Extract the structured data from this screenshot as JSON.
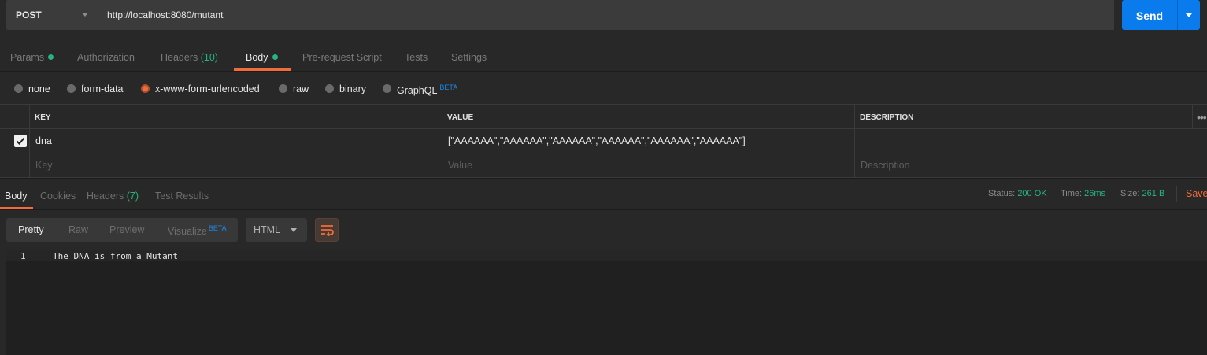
{
  "request": {
    "method": "POST",
    "url": "http://localhost:8080/mutant",
    "send_label": "Send"
  },
  "request_tabs": {
    "params": "Params",
    "authorization": "Authorization",
    "headers": "Headers",
    "headers_count": "(10)",
    "body": "Body",
    "prerequest": "Pre-request Script",
    "tests": "Tests",
    "settings": "Settings"
  },
  "body_types": {
    "none": "none",
    "form_data": "form-data",
    "urlencoded": "x-www-form-urlencoded",
    "raw": "raw",
    "binary": "binary",
    "graphql": "GraphQL",
    "beta": "BETA",
    "selected": "x-www-form-urlencoded"
  },
  "params_table": {
    "headers": {
      "key": "KEY",
      "value": "VALUE",
      "description": "DESCRIPTION"
    },
    "rows": [
      {
        "checked": true,
        "key": "dna",
        "value": "[\"AAAAAA\",\"AAAAAA\",\"AAAAAA\",\"AAAAAA\",\"AAAAAA\",\"AAAAAA\"]",
        "description": ""
      }
    ],
    "placeholders": {
      "key": "Key",
      "value": "Value",
      "description": "Description"
    }
  },
  "response_tabs": {
    "body": "Body",
    "cookies": "Cookies",
    "headers": "Headers",
    "headers_count": "(7)",
    "test_results": "Test Results"
  },
  "response_meta": {
    "status_label": "Status:",
    "status_value": "200 OK",
    "time_label": "Time:",
    "time_value": "26ms",
    "size_label": "Size:",
    "size_value": "261 B",
    "save_label": "Save"
  },
  "response_view": {
    "pretty": "Pretty",
    "raw": "Raw",
    "preview": "Preview",
    "visualize": "Visualize",
    "beta": "BETA",
    "format": "HTML"
  },
  "response_body": {
    "line_number": "1",
    "line_text": "The DNA is from a Mutant"
  },
  "colors": {
    "accent": "#f26b3a",
    "send_button": "#097bed",
    "status_green": "#26b47f",
    "background": "#282828"
  },
  "icons": {
    "checkbox": "check-icon",
    "wrap": "wrap-lines-icon",
    "more": "more-dots-icon"
  }
}
